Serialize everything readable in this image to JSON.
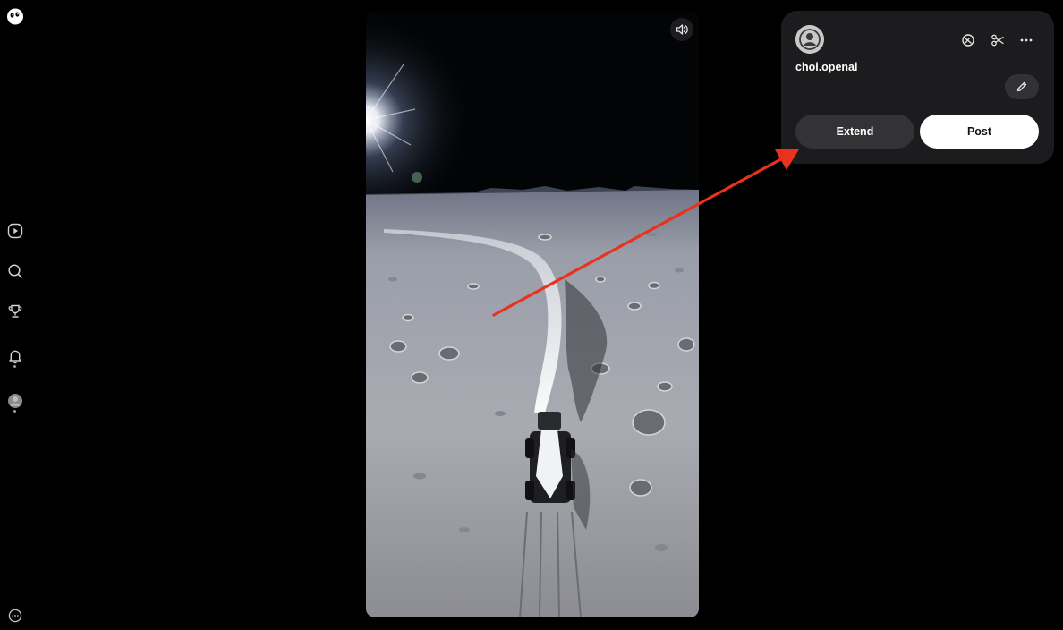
{
  "profile": {
    "username": "choi.openai"
  },
  "actions": {
    "extend_label": "Extend",
    "post_label": "Post"
  },
  "icons": {
    "logo": "app-logo-icon",
    "nav": [
      "play-icon",
      "search-icon",
      "trophy-icon",
      "bell-icon",
      "profile-avatar"
    ],
    "more": "ellipsis-circle-icon",
    "sound": "speaker-icon",
    "remix": "remix-icon",
    "cut": "scissors-icon",
    "menu": "more-horizontal-icon",
    "edit": "pencil-icon"
  },
  "colors": {
    "background": "#000000",
    "panel": "#1c1c1e",
    "annotation_arrow": "#e8321e"
  }
}
